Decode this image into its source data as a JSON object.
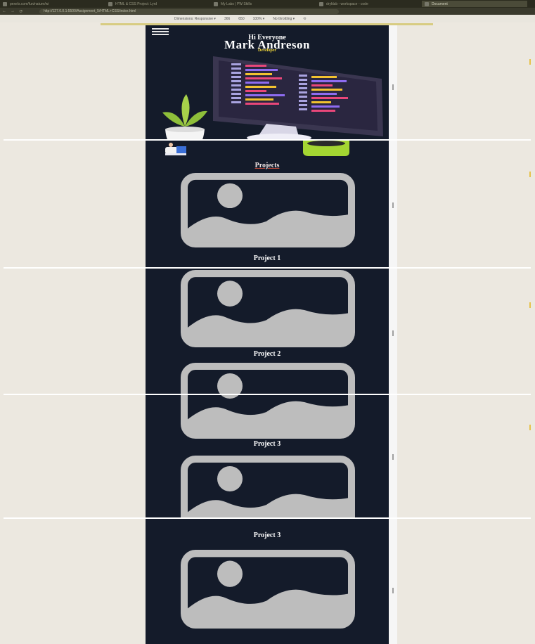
{
  "browser": {
    "tabs": [
      {
        "label": "pexels.com/fun/nature/wi"
      },
      {
        "label": "HTML & CSS Project: Lyrd"
      },
      {
        "label": "My Labs | PW Skills"
      },
      {
        "label": "dryklab - workspace - code"
      },
      {
        "label": "Document"
      }
    ],
    "url": "http://127.0.0.1:5500/Assignment_5/HTML+CSS/index.html"
  },
  "devtools": {
    "dimensions_label": "Dimensions: Responsive ▾",
    "width": "366",
    "height": "650",
    "zoom": "100% ▾",
    "throttle": "No throttling ▾"
  },
  "hero": {
    "greeting": "Hi Everyone",
    "name": "Mark Andreson",
    "role": "Developer"
  },
  "projects": {
    "title": "Projects",
    "labels": [
      "Project 1",
      "Project 2",
      "Project 3",
      "Project 3"
    ]
  },
  "colors": {
    "phone_bg": "#141b2a",
    "role": "#f2d83a",
    "placeholder": "#bdbdbd"
  }
}
